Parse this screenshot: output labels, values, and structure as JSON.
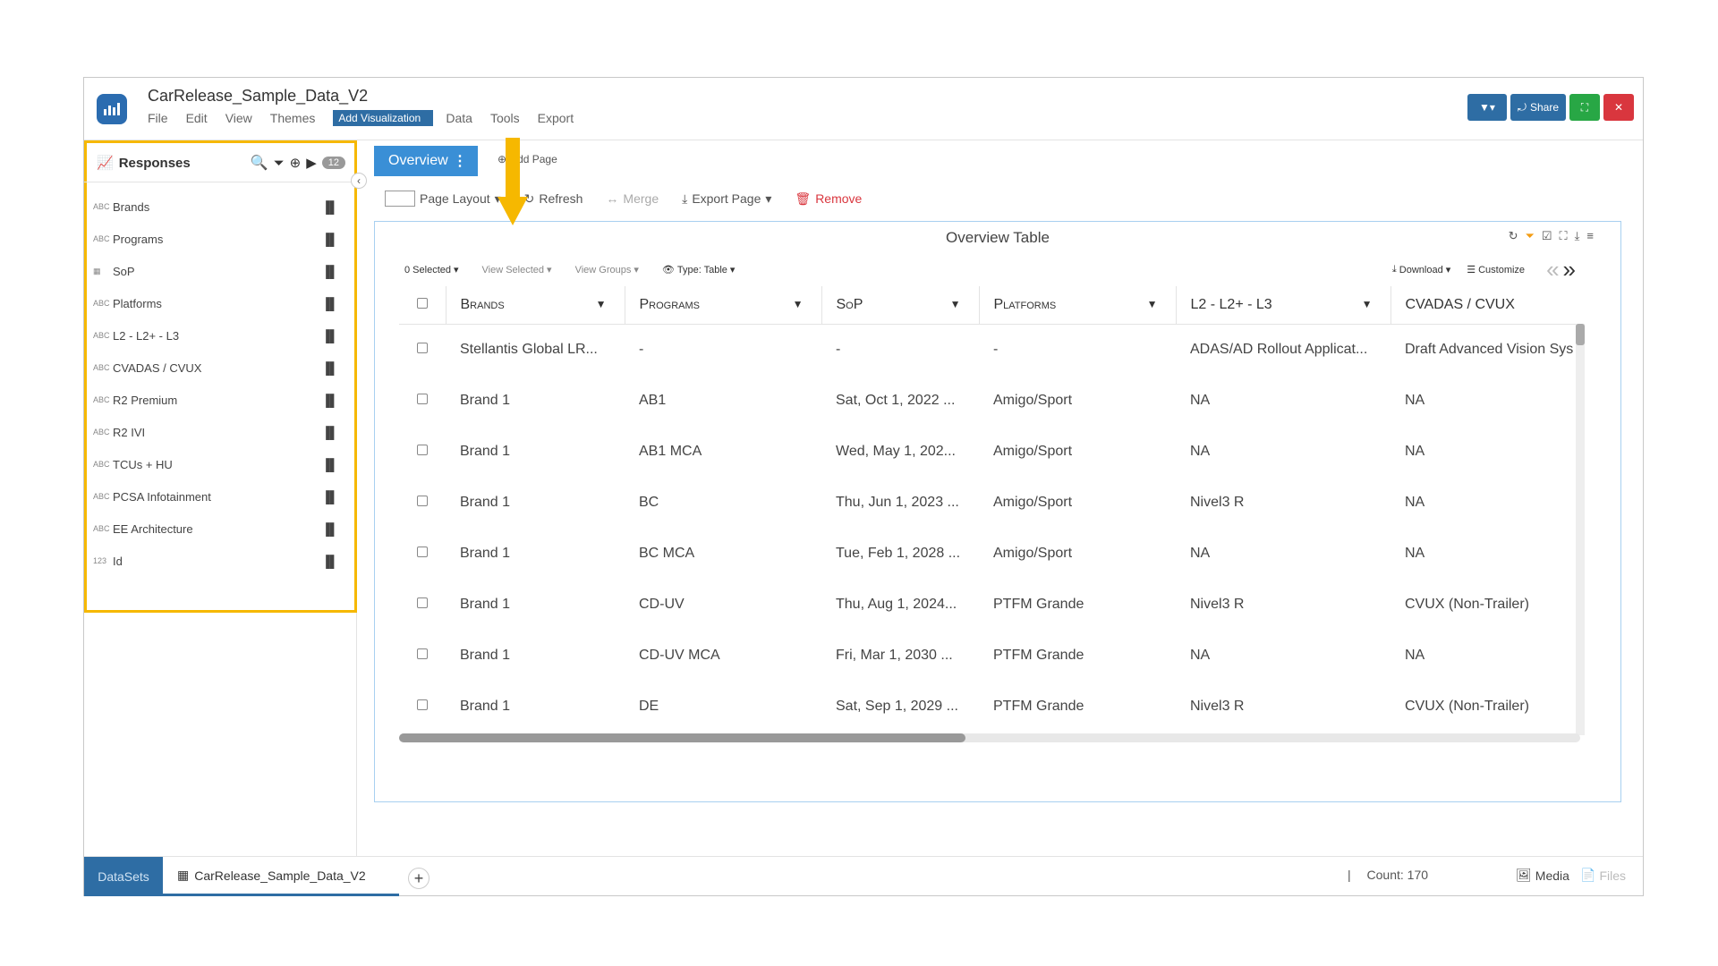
{
  "app": {
    "title": "CarRelease_Sample_Data_V2",
    "menu": [
      "File",
      "Edit",
      "View",
      "Themes",
      "Add Visualization",
      "Data",
      "Tools",
      "Export"
    ],
    "top_buttons": {
      "share": "Share"
    }
  },
  "responses": {
    "title": "Responses",
    "count": "12",
    "fields": [
      {
        "type": "ABC",
        "name": "Brands"
      },
      {
        "type": "ABC",
        "name": "Programs"
      },
      {
        "type": "table",
        "name": "SoP"
      },
      {
        "type": "ABC",
        "name": "Platforms"
      },
      {
        "type": "ABC",
        "name": "L2 - L2+ - L3"
      },
      {
        "type": "ABC",
        "name": "CVADAS / CVUX"
      },
      {
        "type": "ABC",
        "name": "R2 Premium"
      },
      {
        "type": "ABC",
        "name": "R2 IVI"
      },
      {
        "type": "ABC",
        "name": "TCUs + HU"
      },
      {
        "type": "ABC",
        "name": "PCSA Infotainment"
      },
      {
        "type": "ABC",
        "name": "EE Architecture"
      },
      {
        "type": "123",
        "name": "Id"
      }
    ]
  },
  "page": {
    "tab_label": "Overview",
    "add_page": "Add Page",
    "toolbar": {
      "page_layout": "Page Layout",
      "refresh": "Refresh",
      "merge": "Merge",
      "export_page": "Export Page",
      "remove": "Remove"
    }
  },
  "table_panel": {
    "title": "Overview Table",
    "selected": "0 Selected",
    "view_selected": "View Selected",
    "view_groups": "View Groups",
    "type": "Type: Table",
    "download": "Download",
    "customize": "Customize",
    "columns": [
      "Brands",
      "Programs",
      "SoP",
      "Platforms",
      "L2 - L2+ - L3",
      "CVADAS / CVUX"
    ],
    "rows": [
      [
        "Stellantis Global LR...",
        "-",
        "-",
        "-",
        "ADAS/AD Rollout Applicat...",
        "Draft Advanced Vision Sys"
      ],
      [
        "Brand 1",
        "AB1",
        "Sat, Oct 1, 2022 ...",
        "Amigo/Sport",
        "NA",
        "NA"
      ],
      [
        "Brand 1",
        "AB1 MCA",
        "Wed, May 1, 202...",
        "Amigo/Sport",
        "NA",
        "NA"
      ],
      [
        "Brand 1",
        "BC",
        "Thu, Jun 1, 2023 ...",
        "Amigo/Sport",
        "Nivel3 R",
        "NA"
      ],
      [
        "Brand 1",
        "BC MCA",
        "Tue, Feb 1, 2028 ...",
        "Amigo/Sport",
        "NA",
        "NA"
      ],
      [
        "Brand 1",
        "CD-UV",
        "Thu, Aug 1, 2024...",
        "PTFM Grande",
        "Nivel3 R",
        "CVUX (Non-Trailer)"
      ],
      [
        "Brand 1",
        "CD-UV MCA",
        "Fri, Mar 1, 2030 ...",
        "PTFM Grande",
        "NA",
        "NA"
      ],
      [
        "Brand 1",
        "DE",
        "Sat, Sep 1, 2029 ...",
        "PTFM Grande",
        "Nivel3 R",
        "CVUX (Non-Trailer)"
      ]
    ]
  },
  "footer": {
    "datasets_tab": "DataSets",
    "dataset_name": "CarRelease_Sample_Data_V2",
    "count_sep": "|",
    "count": "Count: 170",
    "media": "Media",
    "files": "Files"
  },
  "colors": {
    "accent": "#2e6da4",
    "highlight": "#f6b800",
    "tab": "#3a8fd6"
  }
}
